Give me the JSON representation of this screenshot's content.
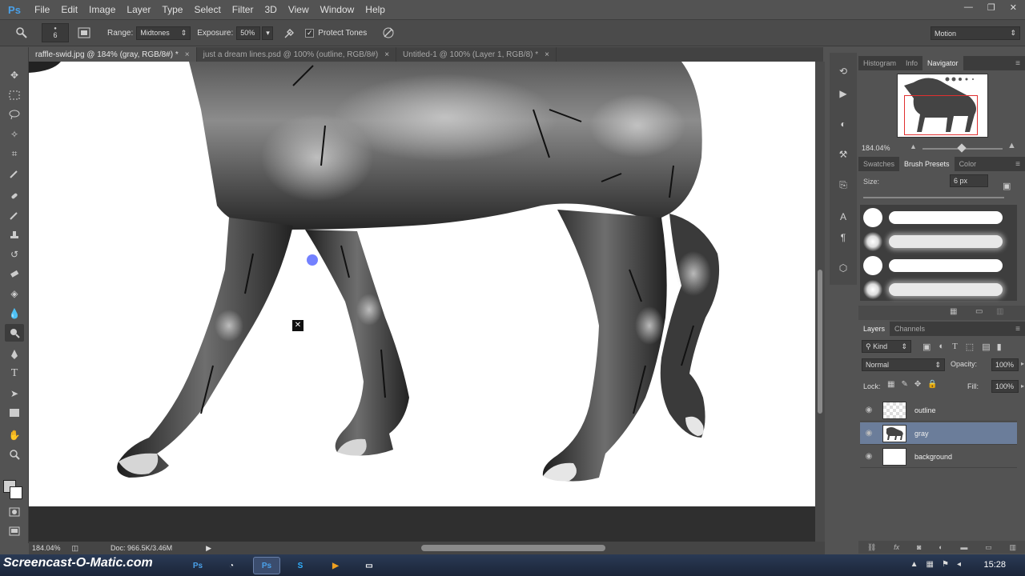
{
  "app": {
    "logo": "Ps"
  },
  "menu": [
    "File",
    "Edit",
    "Image",
    "Layer",
    "Type",
    "Select",
    "Filter",
    "3D",
    "View",
    "Window",
    "Help"
  ],
  "window_controls": [
    "—",
    "❐",
    "✕"
  ],
  "options": {
    "brush_size": "6",
    "range_label": "Range:",
    "range_value": "Midtones",
    "exposure_label": "Exposure:",
    "exposure_value": "50%",
    "protect_tones_label": "Protect Tones",
    "protect_tones_checked": true,
    "workspace": "Motion"
  },
  "tabs": [
    {
      "title": "raffle-swid.jpg @ 184% (gray, RGB/8#) *",
      "active": true
    },
    {
      "title": "just a dream lines.psd @ 100% (outline, RGB/8#)",
      "active": false
    },
    {
      "title": "Untitled-1 @ 100% (Layer 1, RGB/8) *",
      "active": false
    }
  ],
  "tab_close": "×",
  "status": {
    "zoom": "184.04%",
    "doc": "Doc: 966.5K/3.46M"
  },
  "navigator": {
    "tabs": [
      "Histogram",
      "Info",
      "Navigator"
    ],
    "active_tab": "Navigator",
    "zoom": "184.04%"
  },
  "brushes": {
    "tabs": [
      "Swatches",
      "Brush Presets",
      "Color"
    ],
    "active_tab": "Brush Presets",
    "size_label": "Size:",
    "size_value": "6 px"
  },
  "layers": {
    "tabs": [
      "Layers",
      "Channels"
    ],
    "active_tab": "Layers",
    "filter": "Kind",
    "blend_mode": "Normal",
    "opacity_label": "Opacity:",
    "opacity_value": "100%",
    "lock_label": "Lock:",
    "fill_label": "Fill:",
    "fill_value": "100%",
    "items": [
      {
        "name": "outline",
        "selected": false
      },
      {
        "name": "gray",
        "selected": true
      },
      {
        "name": "background",
        "selected": false
      }
    ]
  },
  "taskbar": {
    "watermark": "Screencast-O-Matic.com",
    "clock": "15:28"
  },
  "colors": {
    "ui_dark": "#535353",
    "selected_layer": "#6b7d9a",
    "nav_box": "#e03030",
    "brush_cursor": "#5b6bff"
  }
}
